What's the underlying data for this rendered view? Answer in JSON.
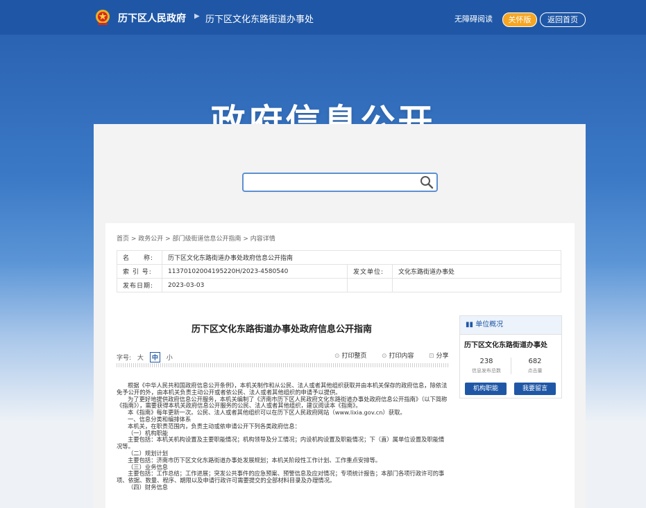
{
  "header": {
    "site_name": "历下区人民政府",
    "dept_name": "历下区文化东路街道办事处",
    "accessibility": "无障碍阅读",
    "care_version": "关怀版",
    "back_home": "返回首页"
  },
  "banner": {
    "title": "政府信息公开"
  },
  "search": {
    "placeholder": ""
  },
  "breadcrumb": "首页 > 政务公开 > 部门级街道信息公开指南 > 内容详情",
  "info": {
    "name_label": "名　　称:",
    "name_value": "历下区文化东路街道办事处政府信息公开指南",
    "index_label": "索 引 号:",
    "index_value": "11370102004195220H/2023-4580540",
    "issuer_label": "发文单位:",
    "issuer_value": "文化东路街道办事处",
    "date_label": "发布日期:",
    "date_value": "2023-03-03"
  },
  "article": {
    "title": "历下区文化东路街道办事处政府信息公开指南",
    "font_label": "字号:",
    "font_large": "大",
    "font_medium": "中",
    "font_small": "小",
    "print_page": "打印整页",
    "print_content": "打印内容",
    "share": "分享",
    "paragraphs": [
      "根据《中华人民共和国政府信息公开条例》，本机关制作和从公民、法人或者其他组织获取并由本机关保存的政府信息，除依法免予公开的外，由本机关负责主动公开或者依公民、法人或者其他组织的申请予以提供。",
      "为了更好地提供政府信息公开服务，本机关编制了《济南市历下区人民政府文化东路街道办事处政府信息公开指南》（以下简称《指南》），需要获得本机关政府信息公开服务的公民、法人或者其他组织，建议阅读本《指南》。",
      "本《指南》每年更新一次。公民、法人或者其他组织可以在历下区人民政府网站（www.lixia.gov.cn）获取。",
      "一、信息分类和编排体系",
      "本机关，在职责范围内，负责主动或依申请公开下列各类政府信息：",
      "（一）机构职能",
      "主要包括：本机关机构设置及主要职能情况；机构领导及分工情况；内设机构设置及职能情况；下（直）属单位设置及职能情况等。",
      "（二）规划计划",
      "主要包括：济南市历下区文化东路街道办事处发展规划；本机关阶段性工作计划、工作重点安排等。",
      "（三）业务信息",
      "主要包括：工作总结；工作进展；突发公共事件的应急预案、预警信息及应对情况；专项统计报告；本部门各项行政许可的事项、依据、数量、程序、期限以及申请行政许可需要提交的全部材料目录及办理情况。",
      "（四）财务信息"
    ]
  },
  "side": {
    "heading": "单位概况",
    "unit_name": "历下区文化东路街道办事处",
    "stat1_value": "238",
    "stat1_label": "信息发布总数",
    "stat2_value": "682",
    "stat2_label": "点击量",
    "btn1": "机构职能",
    "btn2": "我要留言"
  },
  "colors": {
    "primary": "#1f57a6",
    "accent": "#f6a623"
  }
}
